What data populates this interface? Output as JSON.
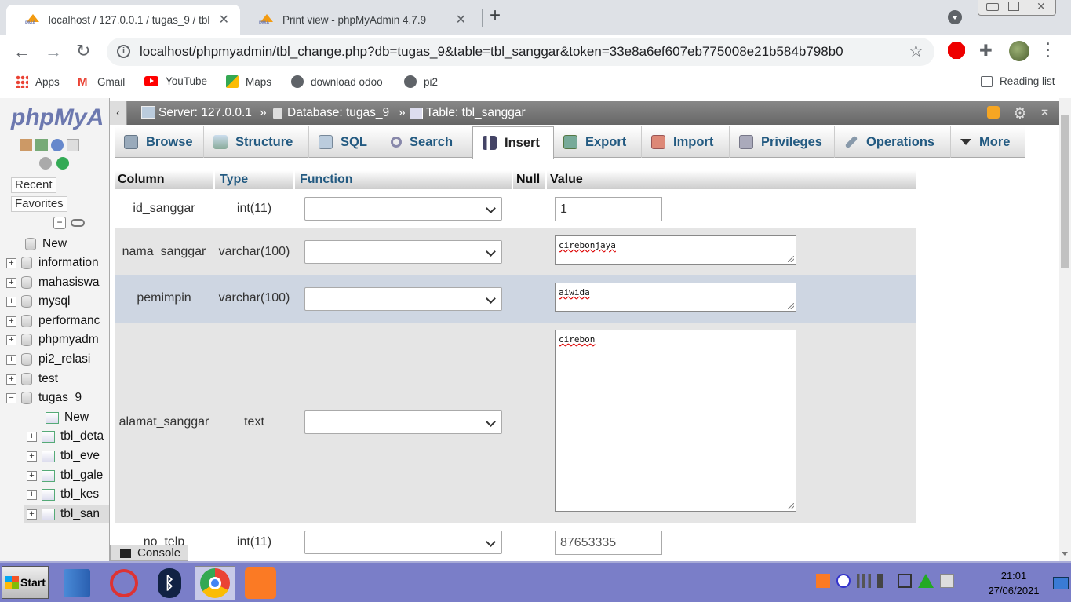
{
  "browser": {
    "tabs": [
      {
        "title": "localhost / 127.0.0.1 / tugas_9 / tbl",
        "active": true
      },
      {
        "title": "Print view - phpMyAdmin 4.7.9",
        "active": false
      }
    ],
    "new_tab_symbol": "+",
    "url": "localhost/phpmyadmin/tbl_change.php?db=tugas_9&table=tbl_sanggar&token=33e8a6ef607eb775008e21b584b798b0",
    "bookmarks": [
      "Apps",
      "Gmail",
      "YouTube",
      "Maps",
      "download odoo",
      "pi2"
    ],
    "reading_list": "Reading list"
  },
  "pma": {
    "logo": "phpMyA",
    "recent": "Recent",
    "favorites": "Favorites",
    "tree": {
      "new_label": "New",
      "databases": [
        "information",
        "mahasiswa",
        "mysql",
        "performanc",
        "phpmyadm",
        "pi2_relasi",
        "test",
        "tugas_9"
      ],
      "tugas_9_items": [
        "New",
        "tbl_deta",
        "tbl_eve",
        "tbl_gale",
        "tbl_kes",
        "tbl_san"
      ]
    },
    "breadcrumb": {
      "server": "Server: 127.0.0.1",
      "database": "Database: tugas_9",
      "table": "Table: tbl_sanggar",
      "sep": "»"
    },
    "menu": [
      "Browse",
      "Structure",
      "SQL",
      "Search",
      "Insert",
      "Export",
      "Import",
      "Privileges",
      "Operations",
      "More"
    ],
    "insert_header": {
      "column": "Column",
      "type": "Type",
      "function": "Function",
      "null": "Null",
      "value": "Value"
    },
    "rows": [
      {
        "column": "id_sanggar",
        "type": "int(11)",
        "function": "",
        "value": "1"
      },
      {
        "column": "nama_sanggar",
        "type": "varchar(100)",
        "function": "",
        "value": "cirebonjaya"
      },
      {
        "column": "pemimpin",
        "type": "varchar(100)",
        "function": "",
        "value": "aiwida"
      },
      {
        "column": "alamat_sanggar",
        "type": "text",
        "function": "",
        "value": "cirebon"
      },
      {
        "column": "no_telp",
        "type": "int(11)",
        "function": "",
        "value": "87653335"
      }
    ],
    "console": "Console"
  },
  "taskbar": {
    "start": "Start",
    "time": "21:01",
    "date": "27/06/2021"
  },
  "colors": {
    "menu_text": "#235a81",
    "server_bar": "#777777",
    "highlight_row": "#ced6e2",
    "taskbar": "#7a7ec8"
  }
}
